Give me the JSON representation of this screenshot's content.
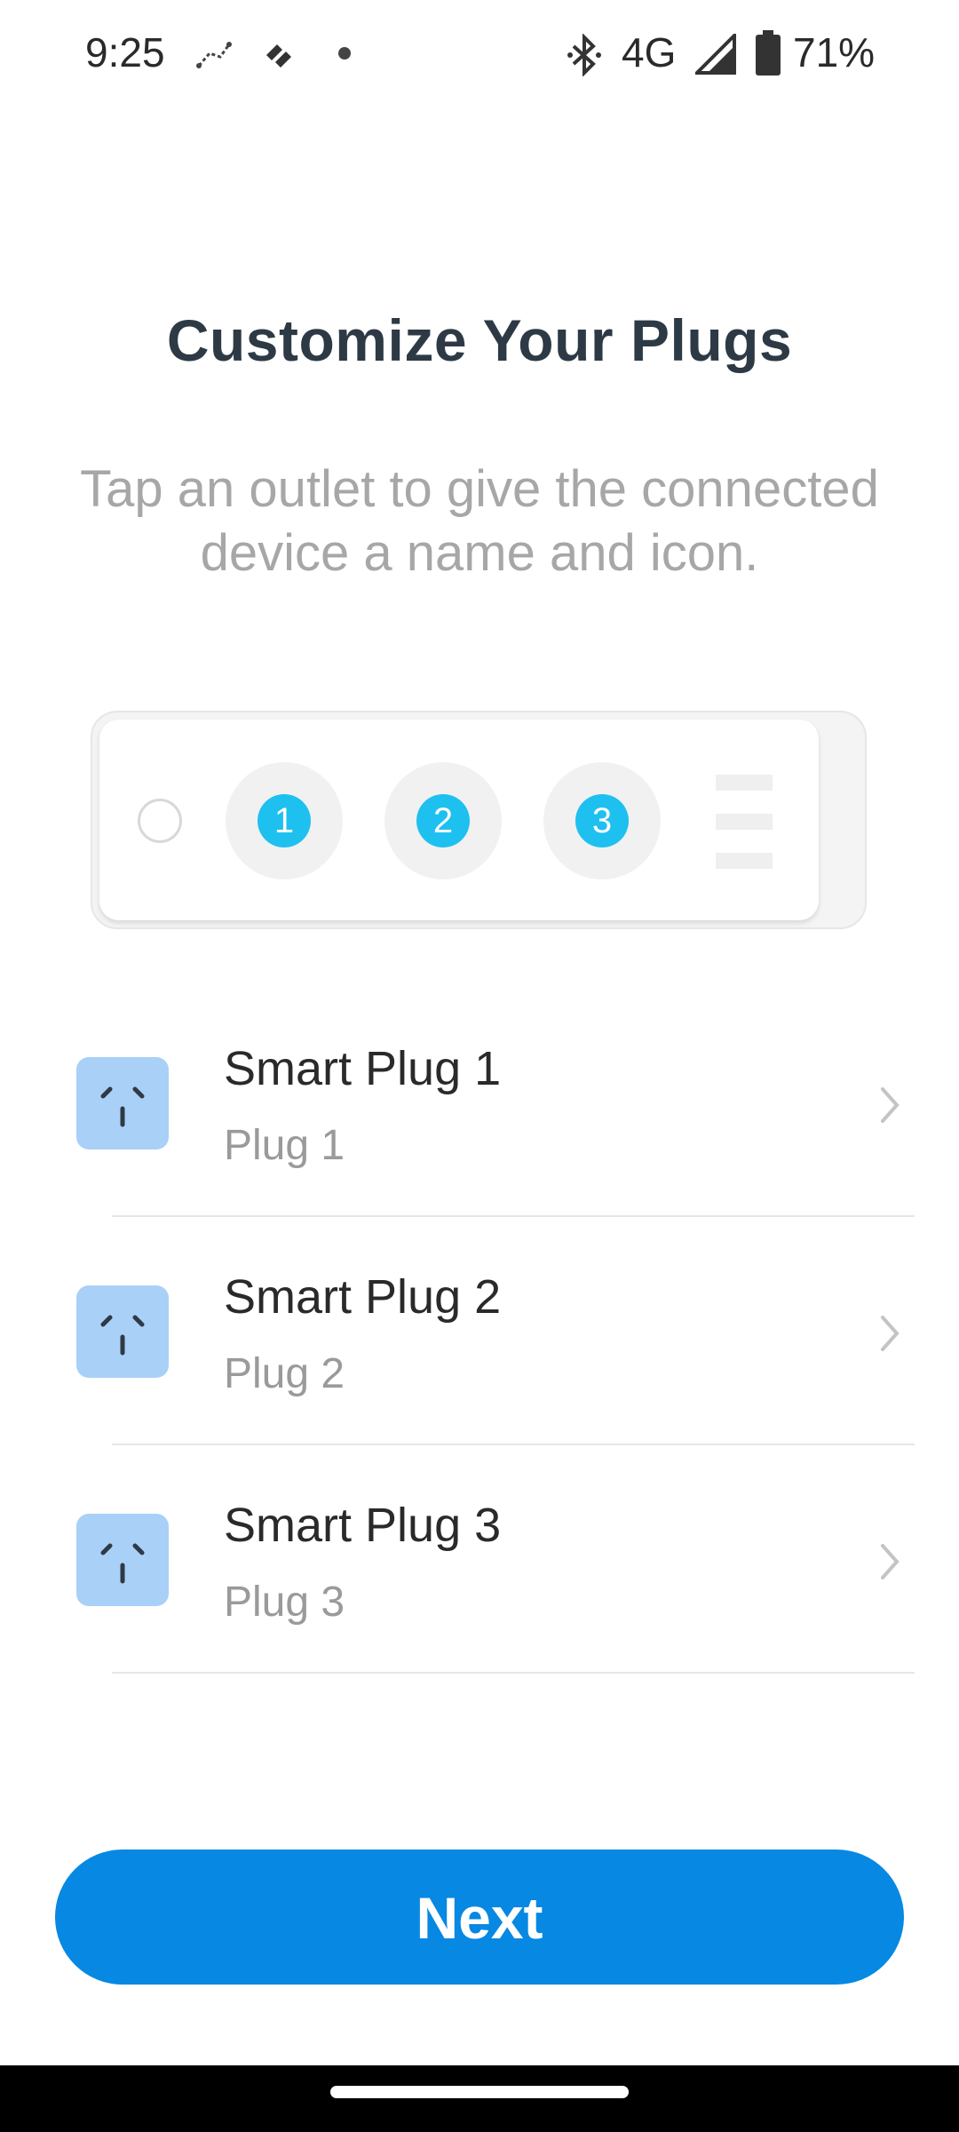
{
  "status_bar": {
    "time": "9:25",
    "network": "4G",
    "battery": "71%",
    "icons": [
      "constellation-icon",
      "fitbit-icon",
      "dot-icon",
      "bluetooth-icon",
      "signal-icon",
      "battery-icon"
    ]
  },
  "header": {
    "title": "Customize Your Plugs",
    "subtitle": "Tap an outlet to give the connected device a name and icon."
  },
  "strip": {
    "outlets": [
      "1",
      "2",
      "3"
    ],
    "accent_color": "#1ec0f0"
  },
  "plugs": [
    {
      "name": "Smart Plug 1",
      "sub": "Plug 1",
      "icon": "outlet-icon"
    },
    {
      "name": "Smart Plug 2",
      "sub": "Plug 2",
      "icon": "outlet-icon"
    },
    {
      "name": "Smart Plug 3",
      "sub": "Plug 3",
      "icon": "outlet-icon"
    }
  ],
  "footer": {
    "next_label": "Next",
    "button_color": "#0788e3"
  }
}
